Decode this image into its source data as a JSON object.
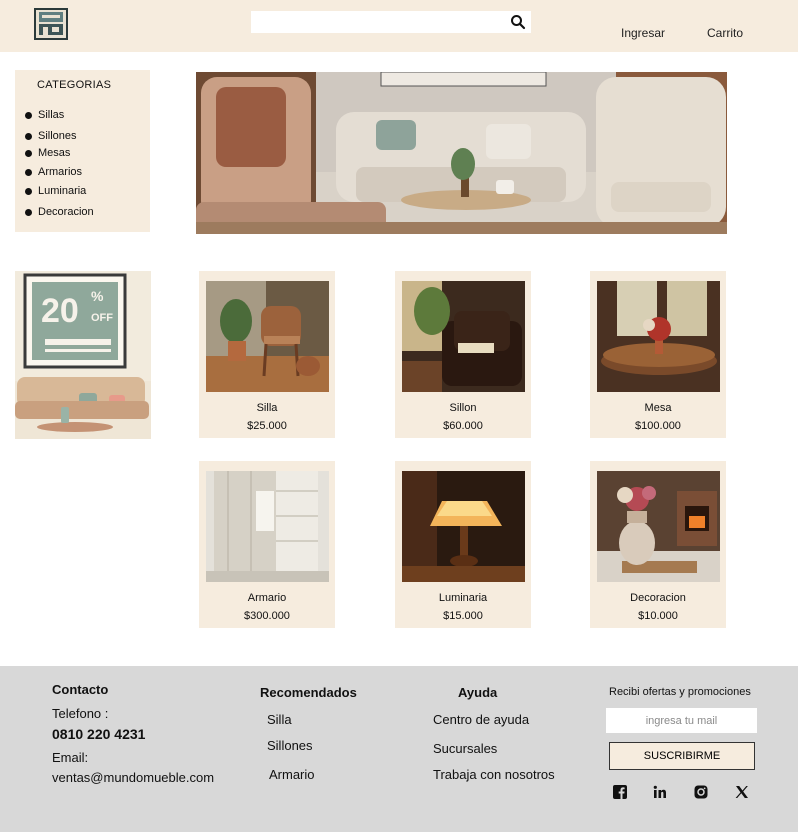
{
  "header": {
    "logo_icon": "storefront-logo-icon",
    "search": {
      "placeholder": "",
      "icon": "search-icon"
    },
    "nav": {
      "login": "Ingresar",
      "cart": "Carrito"
    }
  },
  "categories": {
    "title": "CATEGORIAS",
    "items": [
      "Sillas",
      "Sillones",
      "Mesas",
      "Armarios",
      "Luminaria",
      "Decoracion"
    ]
  },
  "hero": {
    "image": "living-room-banner-image"
  },
  "promo": {
    "big": "20",
    "percent": "%",
    "off": "OFF",
    "image": "discount-banner-image"
  },
  "products": [
    {
      "name": "Silla",
      "price": "$25.000"
    },
    {
      "name": "Sillon",
      "price": "$60.000"
    },
    {
      "name": "Mesa",
      "price": "$100.000"
    },
    {
      "name": "Armario",
      "price": "$300.000"
    },
    {
      "name": "Luminaria",
      "price": "$15.000"
    },
    {
      "name": "Decoracion",
      "price": "$10.000"
    }
  ],
  "footer": {
    "contact": {
      "title": "Contacto",
      "phone_label": "Telefono :",
      "phone": "0810 220 4231",
      "email_label": "Email:",
      "email": "ventas@mundomueble.com"
    },
    "recommended": {
      "title": "Recomendados",
      "items": [
        "Silla",
        "Sillones",
        "Armario"
      ]
    },
    "help": {
      "title": "Ayuda",
      "items": [
        "Centro de ayuda",
        "Sucursales",
        "Trabaja con nosotros"
      ]
    },
    "newsletter": {
      "title": "Recibi ofertas y promociones",
      "placeholder": "ingresa tu mail",
      "button": "SUSCRIBIRME"
    },
    "social": [
      "facebook-icon",
      "linkedin-icon",
      "instagram-icon",
      "x-icon"
    ]
  },
  "colors": {
    "header_bg": "#f6ecde",
    "card_bg": "#f6ecde",
    "footer_bg": "#d8d8d8",
    "promo_teal": "#8fa89b"
  }
}
